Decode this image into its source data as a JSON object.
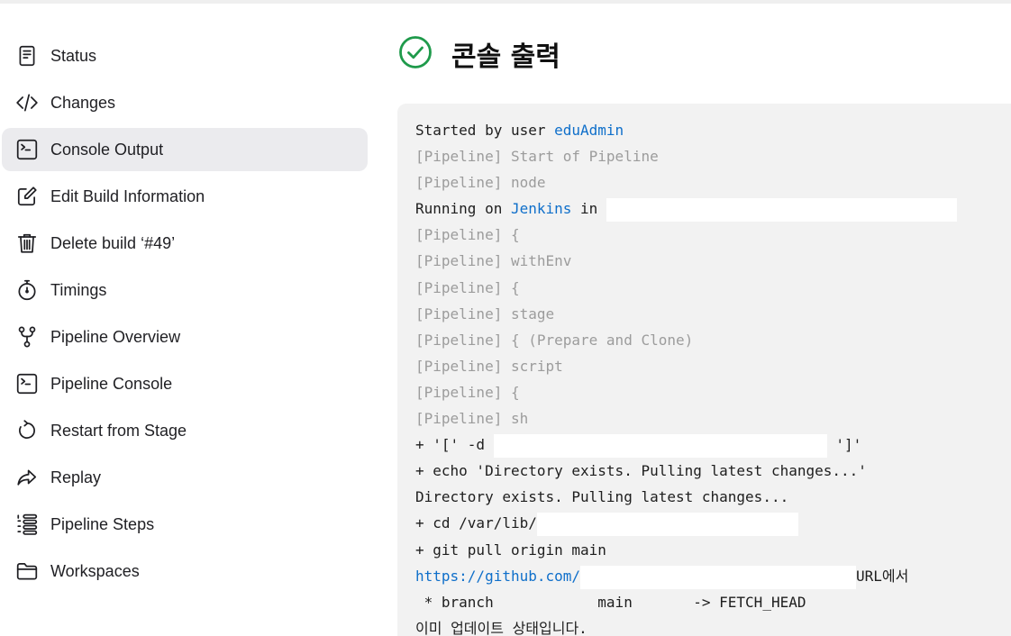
{
  "sidebar": {
    "items": [
      {
        "label": "Status",
        "icon": "document-icon"
      },
      {
        "label": "Changes",
        "icon": "code-icon"
      },
      {
        "label": "Console Output",
        "icon": "terminal-icon",
        "selected": true
      },
      {
        "label": "Edit Build Information",
        "icon": "edit-icon"
      },
      {
        "label": "Delete build ‘#49’",
        "icon": "trash-icon"
      },
      {
        "label": "Timings",
        "icon": "stopwatch-icon"
      },
      {
        "label": "Pipeline Overview",
        "icon": "pipeline-fork-icon"
      },
      {
        "label": "Pipeline Console",
        "icon": "terminal-icon"
      },
      {
        "label": "Restart from Stage",
        "icon": "restart-icon"
      },
      {
        "label": "Replay",
        "icon": "replay-icon"
      },
      {
        "label": "Pipeline Steps",
        "icon": "steps-list-icon"
      },
      {
        "label": "Workspaces",
        "icon": "folder-icon"
      }
    ]
  },
  "header": {
    "title": "콘솔 출력",
    "status_icon": "success-check-icon"
  },
  "console": {
    "lines": [
      {
        "text": "Started by user ",
        "link": "eduAdmin"
      },
      {
        "text": "[Pipeline] Start of Pipeline"
      },
      {
        "text": "[Pipeline] node"
      },
      {
        "text": "Running on ",
        "link": "Jenkins",
        "after": " in "
      },
      {
        "text": "[Pipeline] {"
      },
      {
        "text": "[Pipeline] withEnv"
      },
      {
        "text": "[Pipeline] {"
      },
      {
        "text": "[Pipeline] stage"
      },
      {
        "text": "[Pipeline] { (Prepare and Clone)"
      },
      {
        "text": "[Pipeline] script"
      },
      {
        "text": "[Pipeline] {"
      },
      {
        "text": "[Pipeline] sh"
      },
      {
        "text": "+ '[' -d ",
        "after": " ']'"
      },
      {
        "text": "+ echo 'Directory exists. Pulling latest changes...'"
      },
      {
        "text": "Directory exists. Pulling latest changes..."
      },
      {
        "text": "+ cd /var/lib/"
      },
      {
        "text": "+ git pull origin main"
      },
      {
        "link": "https://github.com/",
        "after": "URL에서"
      },
      {
        "text": " * branch            main       -> FETCH_HEAD"
      },
      {
        "text": "이미 업데이트 상태입니다."
      }
    ]
  },
  "colors": {
    "accent_success": "#1f9a4b",
    "link": "#0f6fca",
    "pipeline_text": "#9c9c9c",
    "selected_bg": "#ebebee",
    "console_bg": "#f2f2f2"
  }
}
